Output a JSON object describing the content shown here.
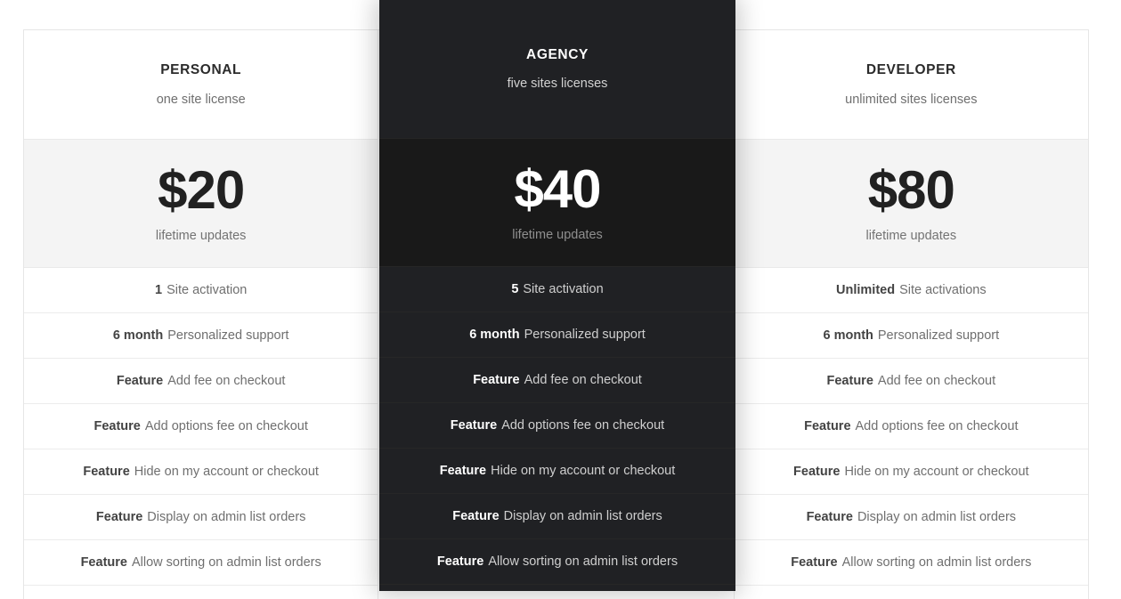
{
  "colors": {
    "page_background": "#ffffff",
    "card_background": "#ffffff",
    "price_band_background": "#f4f4f4",
    "featured_header_background": "#202124",
    "featured_price_background": "#191919",
    "border": "#e9e9e9",
    "muted_text": "#6f6f6f",
    "strong_text": "#434343",
    "featured_text": "#cfcfcf"
  },
  "plans": [
    {
      "id": "personal",
      "name": "PERSONAL",
      "subtitle": "one site license",
      "price": "$20",
      "price_note": "lifetime updates",
      "featured": false,
      "features": [
        {
          "highlight": "1",
          "text": "Site activation"
        },
        {
          "highlight": "6 month",
          "text": "Personalized support"
        },
        {
          "highlight": "Feature",
          "text": "Add fee on checkout"
        },
        {
          "highlight": "Feature",
          "text": "Add options fee on checkout"
        },
        {
          "highlight": "Feature",
          "text": "Hide on my account or checkout"
        },
        {
          "highlight": "Feature",
          "text": "Display on admin list orders"
        },
        {
          "highlight": "Feature",
          "text": "Allow sorting on admin list orders"
        }
      ]
    },
    {
      "id": "agency",
      "name": "AGENCY",
      "subtitle": "five sites licenses",
      "price": "$40",
      "price_note": "lifetime updates",
      "featured": true,
      "features": [
        {
          "highlight": "5",
          "text": "Site activation"
        },
        {
          "highlight": "6 month",
          "text": "Personalized support"
        },
        {
          "highlight": "Feature",
          "text": "Add fee on checkout"
        },
        {
          "highlight": "Feature",
          "text": "Add options fee on checkout"
        },
        {
          "highlight": "Feature",
          "text": "Hide on my account or checkout"
        },
        {
          "highlight": "Feature",
          "text": "Display on admin list orders"
        },
        {
          "highlight": "Feature",
          "text": "Allow sorting on admin list orders"
        }
      ]
    },
    {
      "id": "developer",
      "name": "DEVELOPER",
      "subtitle": "unlimited sites licenses",
      "price": "$80",
      "price_note": "lifetime updates",
      "featured": false,
      "features": [
        {
          "highlight": "Unlimited",
          "text": "Site activations"
        },
        {
          "highlight": "6 month",
          "text": "Personalized support"
        },
        {
          "highlight": "Feature",
          "text": "Add fee on checkout"
        },
        {
          "highlight": "Feature",
          "text": "Add options fee on checkout"
        },
        {
          "highlight": "Feature",
          "text": "Hide on my account or checkout"
        },
        {
          "highlight": "Feature",
          "text": "Display on admin list orders"
        },
        {
          "highlight": "Feature",
          "text": "Allow sorting on admin list orders"
        }
      ]
    }
  ]
}
